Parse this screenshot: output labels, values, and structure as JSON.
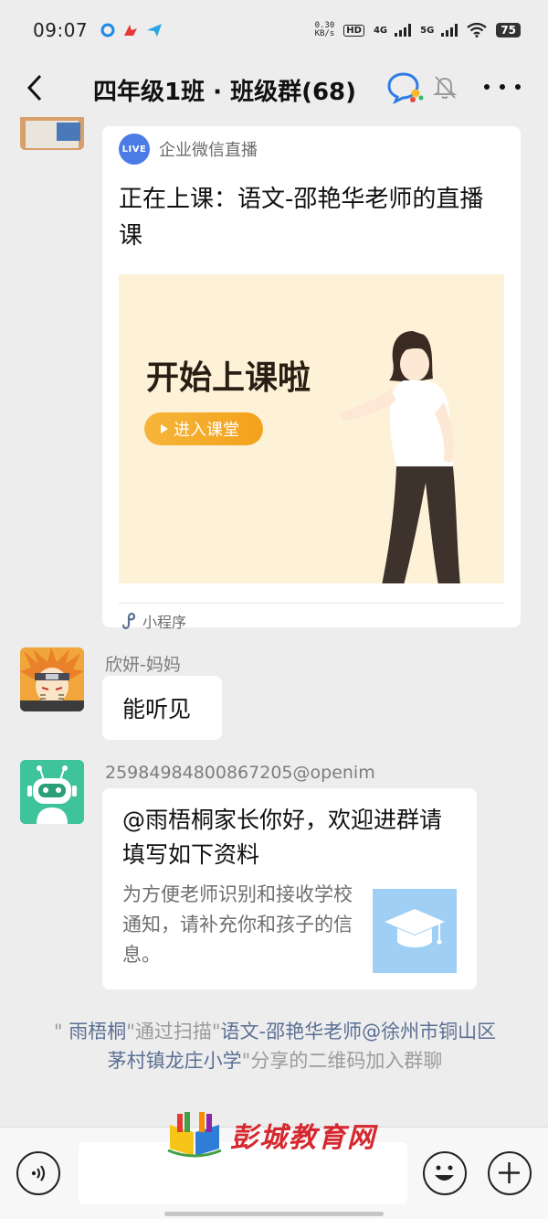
{
  "status_bar": {
    "time": "09:07",
    "speed_value": "0.30",
    "speed_unit": "KB/s",
    "hd_badge": "HD",
    "network1": "4G",
    "network2": "5G",
    "battery": "75"
  },
  "header": {
    "title": "四年级1班 · 班级群(68)",
    "icons": [
      "back-arrow-icon",
      "group-chat-icon",
      "mute-bell-icon",
      "more-icon"
    ]
  },
  "messages": [
    {
      "type": "mini_program_card",
      "source": "企业微信直播",
      "live_badge": "LIVE",
      "title": "正在上课：语文-邵艳华老师的直播课",
      "banner_headline": "开始上课啦",
      "banner_button": "进入课堂",
      "footer": "小程序"
    },
    {
      "type": "text",
      "sender": "欣妍-妈妈",
      "text": "能听见"
    },
    {
      "type": "link_card",
      "sender": "2598498480086​7205@openim",
      "title": "@雨梧桐家长你好，欢迎进群请填写如下资料",
      "description": "为方便老师识别和接收学校通知，请补充你和孩子的信息。"
    }
  ],
  "system_notice": {
    "q1": "\" ",
    "name": "雨梧桐",
    "q2": "\"通过扫描\"",
    "inviter": "语文-邵艳华老师@徐州市铜山区茅村镇龙庄小学",
    "tail": "\"分享的二维码加入群聊"
  },
  "watermark": "彭城教育网",
  "input_bar": {
    "placeholder": ""
  },
  "colors": {
    "background": "#ededed",
    "bubble": "#ffffff",
    "link_highlight": "#5b6f94",
    "live_badge": "#4b7be5",
    "banner_bg": "#fdf2d8",
    "banner_button": "#f3a21c",
    "watermark": "#d6282f"
  }
}
